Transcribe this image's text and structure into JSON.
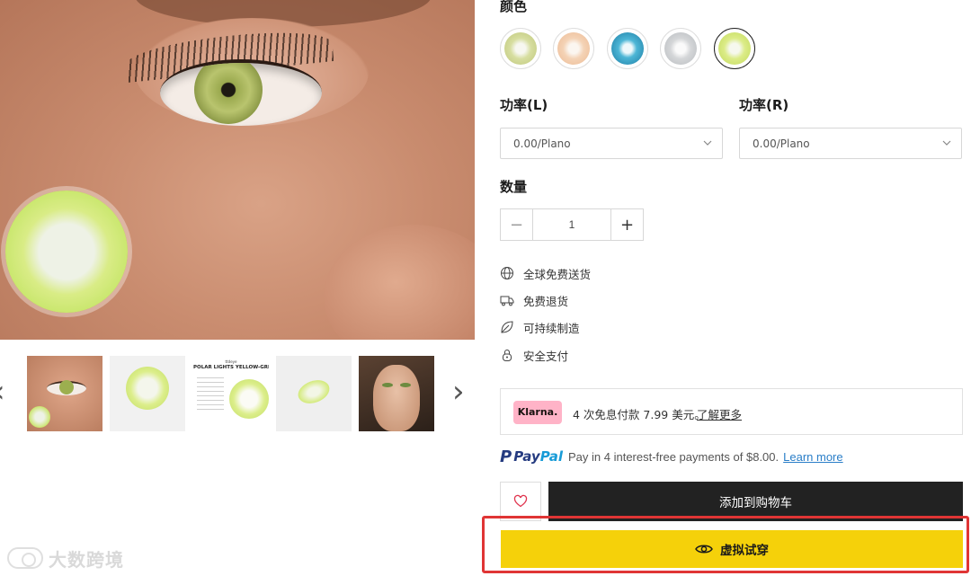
{
  "colors": {
    "cart_button": "#222222",
    "try_on_button": "#f5d10a",
    "highlight_border": "#e03535",
    "klarna_pink": "#ffb3c7",
    "paypal_dark": "#253b80",
    "paypal_light": "#179bd7",
    "link_blue": "#2a7ec8"
  },
  "gallery": {
    "prev_icon": "chevron-left-icon",
    "next_icon": "chevron-right-icon",
    "thumbnails": [
      {
        "name": "eye-closeup",
        "brand": "",
        "title": ""
      },
      {
        "name": "lens-single",
        "brand": "",
        "title": ""
      },
      {
        "name": "product-info-card",
        "brand": "ttdeye",
        "title": "POLAR LIGHTS YELLOW-GREEN"
      },
      {
        "name": "lens-angled",
        "brand": "",
        "title": ""
      },
      {
        "name": "model-portrait",
        "brand": "",
        "title": ""
      }
    ]
  },
  "watermark": {
    "text": "大数跨境"
  },
  "product": {
    "color_label": "颜色",
    "swatches": [
      {
        "name": "yellow-green",
        "color": "#d7dea0",
        "selected": false
      },
      {
        "name": "peach",
        "color": "#f4d3b6",
        "selected": false
      },
      {
        "name": "aqua-blue",
        "color": "#4db6d6",
        "selected": false
      },
      {
        "name": "grey",
        "color": "#d4d6d8",
        "selected": false
      },
      {
        "name": "lime",
        "color": "#dcec88",
        "selected": true
      }
    ],
    "power_left_label": "功率(L)",
    "power_left_value": "0.00/Plano",
    "power_right_label": "功率(R)",
    "power_right_value": "0.00/Plano",
    "quantity_label": "数量",
    "quantity_value": "1",
    "quantity_minus": "−",
    "quantity_plus": "+",
    "features": [
      {
        "icon": "globe-icon",
        "text": "全球免费送货"
      },
      {
        "icon": "truck-icon",
        "text": "免费退货"
      },
      {
        "icon": "leaf-icon",
        "text": "可持续制造"
      },
      {
        "icon": "lock-icon",
        "text": "安全支付"
      }
    ]
  },
  "klarna": {
    "badge": "Klarna.",
    "text": "4 次免息付款 7.99 美元。",
    "link": "了解更多"
  },
  "paypal": {
    "logo_pay": "Pay",
    "logo_pal": "Pal",
    "text": "Pay in 4 interest-free payments of $8.00.",
    "link": "Learn more"
  },
  "actions": {
    "wishlist_icon": "heart-icon",
    "add_to_cart": "添加到购物车",
    "try_on_icon": "eye-icon",
    "try_on": "虚拟试穿"
  }
}
